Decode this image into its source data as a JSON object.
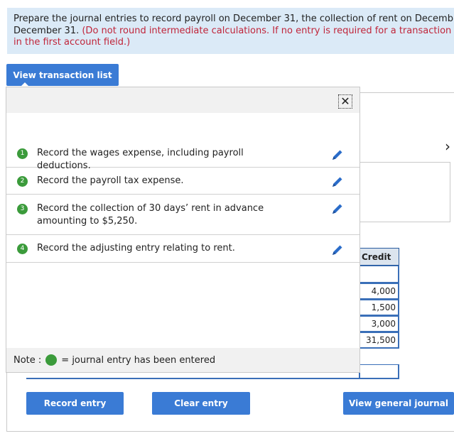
{
  "instructions": {
    "line1": "Prepare the journal entries to record payroll on December 31, the collection of rent on Decemb",
    "line2_black": "December 31. ",
    "line2_red": "(Do not round intermediate calculations. If no entry is required for a transaction",
    "line3_red": "in the first account field.)"
  },
  "view_list_label": "View transaction list",
  "popup": {
    "close_glyph": "✕",
    "items": [
      {
        "num": "1",
        "text": "Record the wages expense, including payroll deductions."
      },
      {
        "num": "2",
        "text": "Record the payroll tax expense."
      },
      {
        "num": "3",
        "text": "Record the collection of 30 days’ rent in advance amounting to $5,250."
      },
      {
        "num": "4",
        "text": "Record the adjusting entry relating to rent."
      }
    ],
    "note_prefix": "Note :",
    "note_suffix": "= journal entry has been entered"
  },
  "journal": {
    "credit_header": "Credit",
    "credit_values": [
      "4,000",
      "1,500",
      "3,000",
      "31,500"
    ],
    "chevron": "›"
  },
  "buttons": {
    "record_entry": "Record entry",
    "clear_entry": "Clear entry",
    "view_general_journal": "View general journal"
  },
  "colors": {
    "button_blue": "#3a7bd5",
    "instruction_bg": "#dbeaf7",
    "entered_green": "#3b9b3b",
    "warning_red": "#c0253a"
  }
}
